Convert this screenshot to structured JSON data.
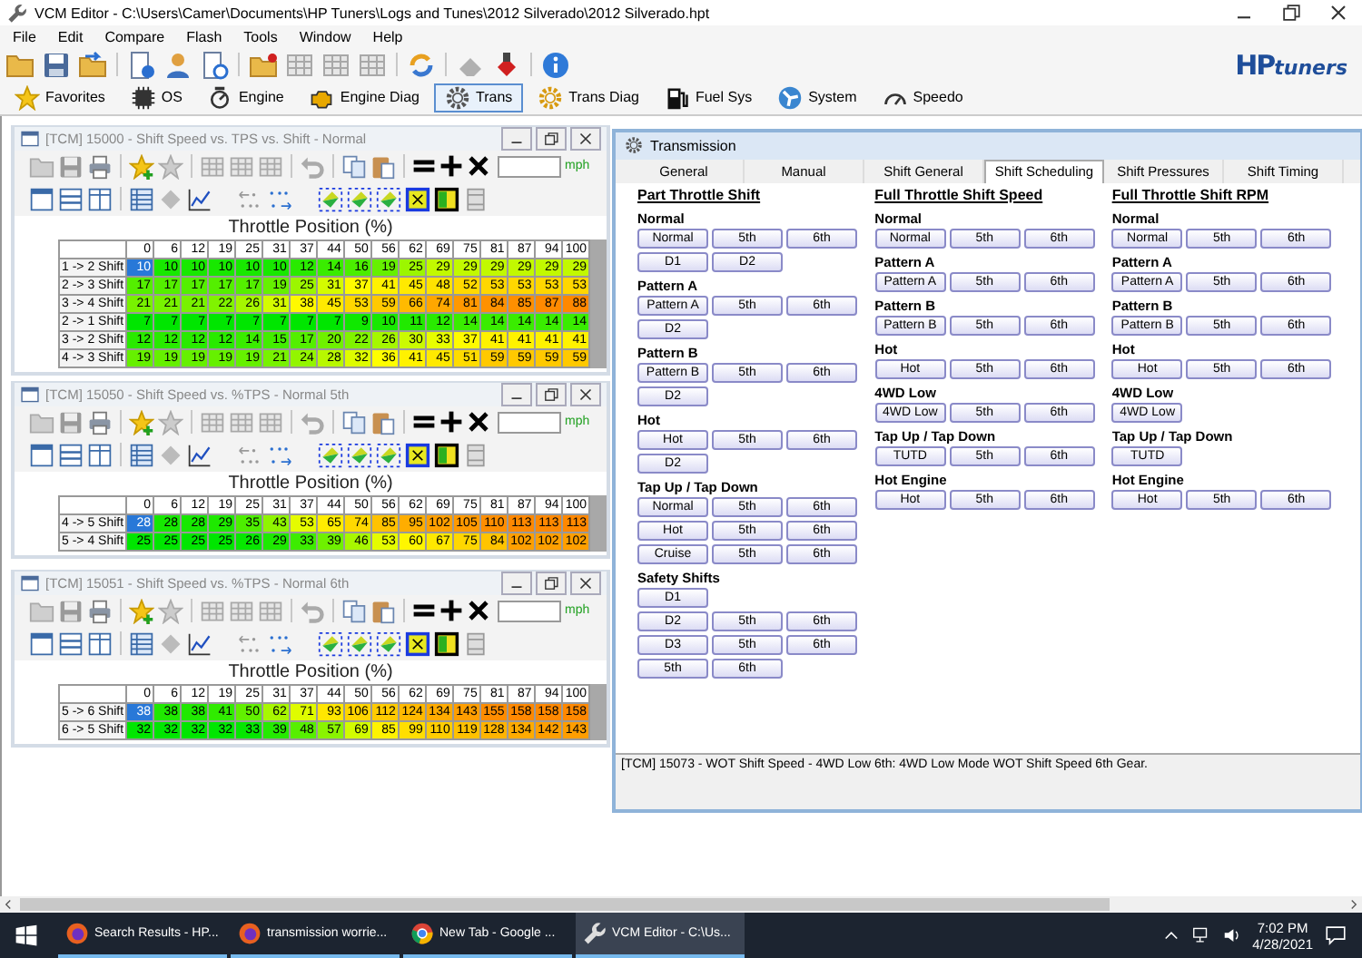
{
  "window": {
    "title": "VCM Editor - C:\\Users\\Camer\\Documents\\HP Tuners\\Logs and Tunes\\2012 Silverado\\2012 Silverado.hpt"
  },
  "menu": [
    "File",
    "Edit",
    "Compare",
    "Flash",
    "Tools",
    "Window",
    "Help"
  ],
  "logo": {
    "part1": "HP",
    "part2": "tuners"
  },
  "nav_tabs": [
    {
      "label": "Favorites",
      "selected": false
    },
    {
      "label": "OS",
      "selected": false
    },
    {
      "label": "Engine",
      "selected": false
    },
    {
      "label": "Engine Diag",
      "selected": false
    },
    {
      "label": "Trans",
      "selected": true
    },
    {
      "label": "Trans Diag",
      "selected": false
    },
    {
      "label": "Fuel Sys",
      "selected": false
    },
    {
      "label": "System",
      "selected": false
    },
    {
      "label": "Speedo",
      "selected": false
    }
  ],
  "tables": [
    {
      "title": "[TCM] 15000 - Shift Speed vs. TPS vs. Shift - Normal",
      "active": false,
      "unit": "mph",
      "axis_label": "Throttle Position (%)",
      "columns": [
        "0",
        "6",
        "12",
        "19",
        "25",
        "31",
        "37",
        "44",
        "50",
        "56",
        "62",
        "69",
        "75",
        "81",
        "87",
        "94",
        "100"
      ],
      "rows": [
        {
          "label": "1 -> 2 Shift",
          "first_cell_selected": true,
          "cells": [
            "10",
            "10",
            "10",
            "10",
            "10",
            "10",
            "12",
            "14",
            "16",
            "19",
            "25",
            "29",
            "29",
            "29",
            "29",
            "29",
            "29"
          ]
        },
        {
          "label": "2 -> 3 Shift",
          "first_cell_selected": false,
          "cells": [
            "17",
            "17",
            "17",
            "17",
            "17",
            "19",
            "25",
            "31",
            "37",
            "41",
            "45",
            "48",
            "52",
            "53",
            "53",
            "53",
            "53"
          ]
        },
        {
          "label": "3 -> 4 Shift",
          "first_cell_selected": false,
          "cells": [
            "21",
            "21",
            "21",
            "22",
            "26",
            "31",
            "38",
            "45",
            "53",
            "59",
            "66",
            "74",
            "81",
            "84",
            "85",
            "87",
            "88"
          ]
        },
        {
          "label": "2 -> 1 Shift",
          "first_cell_selected": false,
          "cells": [
            "7",
            "7",
            "7",
            "7",
            "7",
            "7",
            "7",
            "7",
            "9",
            "10",
            "11",
            "12",
            "14",
            "14",
            "14",
            "14",
            "14"
          ]
        },
        {
          "label": "3 -> 2 Shift",
          "first_cell_selected": false,
          "cells": [
            "12",
            "12",
            "12",
            "12",
            "14",
            "15",
            "17",
            "20",
            "22",
            "26",
            "30",
            "33",
            "37",
            "41",
            "41",
            "41",
            "41"
          ]
        },
        {
          "label": "4 -> 3 Shift",
          "first_cell_selected": false,
          "cells": [
            "19",
            "19",
            "19",
            "19",
            "19",
            "21",
            "24",
            "28",
            "32",
            "36",
            "41",
            "45",
            "51",
            "59",
            "59",
            "59",
            "59"
          ]
        }
      ]
    },
    {
      "title": "[TCM] 15050 - Shift Speed vs. %TPS - Normal 5th",
      "active": false,
      "unit": "mph",
      "axis_label": "Throttle Position (%)",
      "columns": [
        "0",
        "6",
        "12",
        "19",
        "25",
        "31",
        "37",
        "44",
        "50",
        "56",
        "62",
        "69",
        "75",
        "81",
        "87",
        "94",
        "100"
      ],
      "rows": [
        {
          "label": "4 -> 5 Shift",
          "first_cell_selected": true,
          "cells": [
            "28",
            "28",
            "28",
            "29",
            "35",
            "43",
            "53",
            "65",
            "74",
            "85",
            "95",
            "102",
            "105",
            "110",
            "113",
            "113",
            "113"
          ]
        },
        {
          "label": "5 -> 4 Shift",
          "first_cell_selected": false,
          "cells": [
            "25",
            "25",
            "25",
            "25",
            "26",
            "29",
            "33",
            "39",
            "46",
            "53",
            "60",
            "67",
            "75",
            "84",
            "102",
            "102",
            "102"
          ]
        }
      ]
    },
    {
      "title": "[TCM] 15051 - Shift Speed vs. %TPS - Normal 6th",
      "active": false,
      "unit": "mph",
      "axis_label": "Throttle Position (%)",
      "columns": [
        "0",
        "6",
        "12",
        "19",
        "25",
        "31",
        "37",
        "44",
        "50",
        "56",
        "62",
        "69",
        "75",
        "81",
        "87",
        "94",
        "100"
      ],
      "rows": [
        {
          "label": "5 -> 6 Shift",
          "first_cell_selected": true,
          "cells": [
            "38",
            "38",
            "38",
            "41",
            "50",
            "62",
            "71",
            "93",
            "106",
            "112",
            "124",
            "134",
            "143",
            "155",
            "158",
            "158",
            "158"
          ]
        },
        {
          "label": "6 -> 5 Shift",
          "first_cell_selected": false,
          "cells": [
            "32",
            "32",
            "32",
            "32",
            "33",
            "39",
            "48",
            "57",
            "69",
            "85",
            "99",
            "110",
            "119",
            "128",
            "134",
            "142",
            "143"
          ]
        }
      ]
    }
  ],
  "panel": {
    "title": "Transmission",
    "active": true,
    "tabs": [
      {
        "label": "General",
        "selected": false
      },
      {
        "label": "Manual",
        "selected": false
      },
      {
        "label": "Shift General",
        "selected": false
      },
      {
        "label": "Shift Scheduling",
        "selected": true
      },
      {
        "label": "Shift Pressures",
        "selected": false
      },
      {
        "label": "Shift Timing",
        "selected": false
      }
    ],
    "columns": [
      {
        "heading": "Part Throttle Shift",
        "groups": [
          {
            "label": "Normal",
            "rows": [
              [
                "Normal",
                "5th",
                "6th"
              ],
              [
                "D1",
                "D2"
              ]
            ]
          },
          {
            "label": "Pattern A",
            "rows": [
              [
                "Pattern A",
                "5th",
                "6th"
              ],
              [
                "D2"
              ]
            ]
          },
          {
            "label": "Pattern B",
            "rows": [
              [
                "Pattern B",
                "5th",
                "6th"
              ],
              [
                "D2"
              ]
            ]
          },
          {
            "label": "Hot",
            "rows": [
              [
                "Hot",
                "5th",
                "6th"
              ],
              [
                "D2"
              ]
            ]
          },
          {
            "label": "Tap Up / Tap Down",
            "rows": [
              [
                "Normal",
                "5th",
                "6th"
              ],
              [
                "Hot",
                "5th",
                "6th"
              ],
              [
                "Cruise",
                "5th",
                "6th"
              ]
            ]
          },
          {
            "label": "Safety Shifts",
            "rows": [
              [
                "D1"
              ],
              [
                "D2",
                "5th",
                "6th"
              ],
              [
                "D3",
                "5th",
                "6th"
              ],
              [
                "5th",
                "6th"
              ]
            ]
          }
        ]
      },
      {
        "heading": "Full Throttle Shift Speed",
        "groups": [
          {
            "label": "Normal",
            "rows": [
              [
                "Normal",
                "5th",
                "6th"
              ]
            ]
          },
          {
            "label": "Pattern A",
            "rows": [
              [
                "Pattern A",
                "5th",
                "6th"
              ]
            ]
          },
          {
            "label": "Pattern B",
            "rows": [
              [
                "Pattern B",
                "5th",
                "6th"
              ]
            ]
          },
          {
            "label": "Hot",
            "rows": [
              [
                "Hot",
                "5th",
                "6th"
              ]
            ]
          },
          {
            "label": "4WD Low",
            "rows": [
              [
                "4WD Low",
                "5th",
                "6th"
              ]
            ]
          },
          {
            "label": "Tap Up / Tap Down",
            "rows": [
              [
                "TUTD",
                "5th",
                "6th"
              ]
            ]
          },
          {
            "label": "Hot Engine",
            "rows": [
              [
                "Hot",
                "5th",
                "6th"
              ]
            ]
          }
        ]
      },
      {
        "heading": "Full Throttle Shift RPM",
        "groups": [
          {
            "label": "Normal",
            "rows": [
              [
                "Normal",
                "5th",
                "6th"
              ]
            ]
          },
          {
            "label": "Pattern A",
            "rows": [
              [
                "Pattern A",
                "5th",
                "6th"
              ]
            ]
          },
          {
            "label": "Pattern B",
            "rows": [
              [
                "Pattern B",
                "5th",
                "6th"
              ]
            ]
          },
          {
            "label": "Hot",
            "rows": [
              [
                "Hot",
                "5th",
                "6th"
              ]
            ]
          },
          {
            "label": "4WD Low",
            "rows": [
              [
                "4WD Low"
              ]
            ]
          },
          {
            "label": "Tap Up / Tap Down",
            "rows": [
              [
                "TUTD"
              ]
            ]
          },
          {
            "label": "Hot Engine",
            "rows": [
              [
                "Hot",
                "5th",
                "6th"
              ]
            ]
          }
        ]
      }
    ],
    "status": "[TCM] 15073 - WOT Shift Speed - 4WD Low 6th: 4WD Low Mode WOT Shift Speed 6th Gear."
  },
  "taskbar": {
    "tasks": [
      {
        "label": "Search Results - HP...",
        "kind": "firefox",
        "selected": false
      },
      {
        "label": "transmission worrie...",
        "kind": "firefox",
        "selected": false
      },
      {
        "label": "New Tab - Google ...",
        "kind": "chrome",
        "selected": false
      },
      {
        "label": "VCM Editor - C:\\Us...",
        "kind": "tool",
        "selected": true
      }
    ],
    "time": "7:02 PM",
    "date": "4/28/2021"
  }
}
